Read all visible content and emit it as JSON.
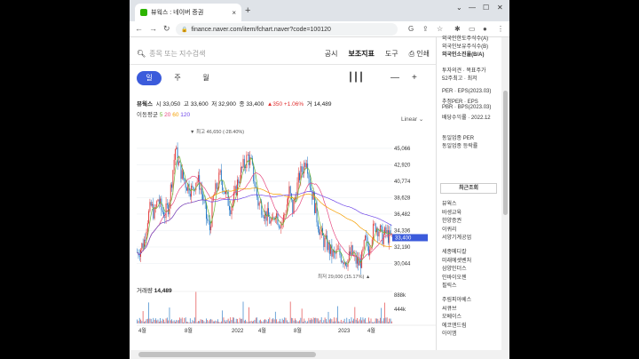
{
  "browser": {
    "tab_title": "뷰웍스 : 네이버 증권",
    "url": "finance.naver.com/item/fchart.naver?code=100120",
    "new_tab": "+",
    "tab_close": "×"
  },
  "search": {
    "placeholder": "종목 또는 지수검색",
    "links": [
      "공시",
      "보조지표",
      "도구"
    ],
    "print": "인쇄"
  },
  "period_tabs": [
    "일",
    "주",
    "월"
  ],
  "quote": {
    "name": "뷰웍스",
    "open_label": "시",
    "open": "33,050",
    "high_label": "고",
    "high": "33,600",
    "low_label": "저",
    "low": "32,900",
    "close_label": "종",
    "close": "33,400",
    "change": "▲350 +1.06%",
    "volume_label": "거",
    "volume": "14,489"
  },
  "moving_avg": {
    "label": "이동평균",
    "periods": [
      "5",
      "20",
      "60",
      "120"
    ],
    "colors": [
      "#6bb536",
      "#e64980",
      "#f59f00",
      "#7048e8"
    ]
  },
  "scale_mode": "Linear",
  "chart_data": {
    "type": "candlestick",
    "y_ticks": [
      30044,
      32190,
      34336,
      36482,
      38628,
      40774,
      42920,
      45066
    ],
    "current_price": "33,400",
    "high_annotation": "최고 46,650 (-28.40%)",
    "low_annotation": "최저 29,000 (15.17%)",
    "x_labels": [
      "4월",
      "8월",
      "2022",
      "4월",
      "8월",
      "2023",
      "4월"
    ],
    "close_path_values": [
      31500,
      32000,
      33000,
      36000,
      37500,
      36500,
      38500,
      37000,
      36500,
      37500,
      41000,
      45000,
      43000,
      41500,
      40500,
      40000,
      39500,
      41000,
      40500,
      38500,
      36000,
      34500,
      38500,
      40000,
      41500,
      40000,
      38500,
      37500,
      38500,
      40500,
      42000,
      43000,
      44000,
      43000,
      40500,
      38000,
      37500,
      36500,
      36000,
      35000,
      37000,
      35500,
      35500,
      37000,
      39500,
      37000,
      39500,
      41500,
      42500,
      44000,
      40500,
      38500,
      36000,
      34000,
      33000,
      32500,
      31500,
      31000,
      31500,
      31000,
      30500,
      30500,
      31500,
      30500,
      30000,
      30500,
      33000,
      32000,
      34000,
      35000,
      34500,
      33500,
      34000,
      33400
    ],
    "volume_ticks": [
      "888k",
      "444k"
    ],
    "volume_label": "거래량",
    "volume_value": "14,489"
  },
  "sidebar": {
    "top_items": [
      "외국인한도주식수(A)",
      "외국인보유주식수(B)",
      "외국인소진율(B/A)"
    ],
    "invest_items": [
      "투자의견 · 목표주가",
      "52주최고 · 최저"
    ],
    "per_items": [
      "PER · EPS(2023.03)",
      "추정PER · EPS",
      "PBR · BPS(2023.03)",
      "배당수익률 · 2022.12"
    ],
    "industry_items": [
      "동일업종 PER",
      "동일업종 등락률"
    ],
    "recent_title": "최근조회",
    "recent_items": [
      "뷰웍스",
      "바셍교육",
      "한양증권",
      "이퀴리",
      "서양기계공업",
      "세종메디칼",
      "미래에셋벤처",
      "삼양인더스",
      "인바이오젠",
      "필릭스",
      "주림피아베스",
      "씨큐브",
      "모베이스",
      "에코앤드림",
      "아이엠"
    ],
    "recent_nums": [
      "3",
      "",
      "",
      "",
      "",
      "",
      "",
      "",
      "",
      "2",
      "",
      "",
      "",
      "4",
      "2"
    ]
  }
}
